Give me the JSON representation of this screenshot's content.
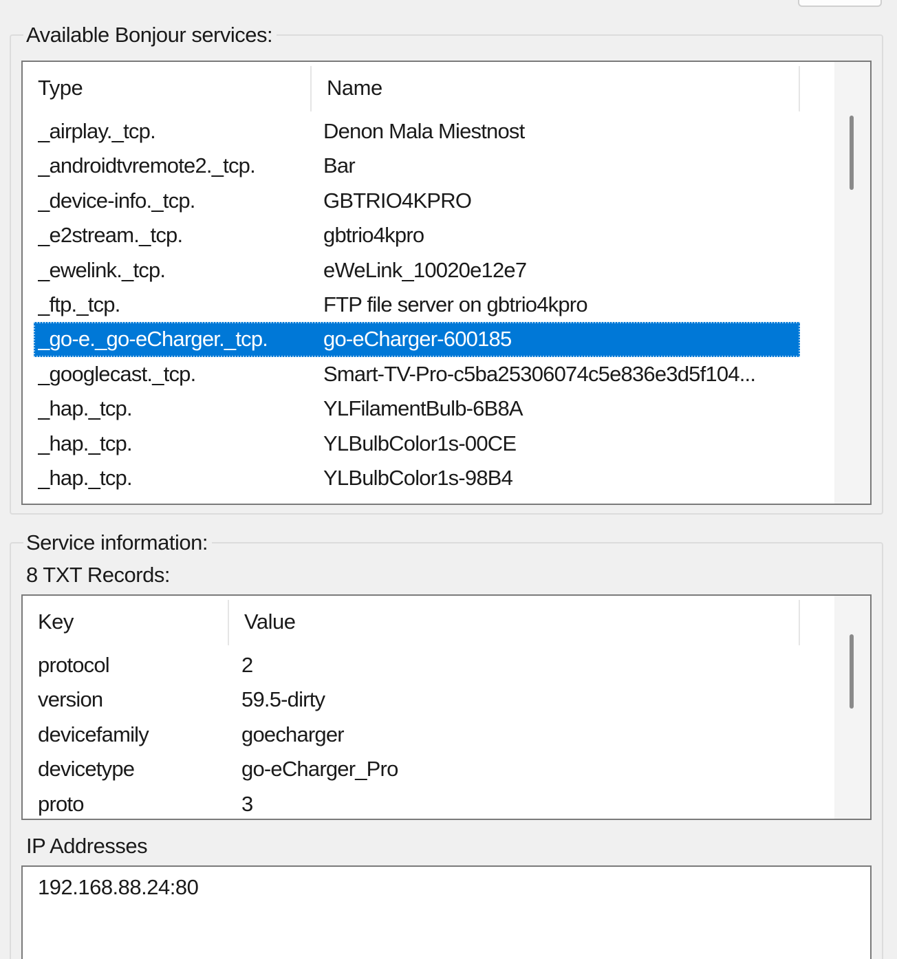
{
  "services_group": {
    "title": "Available Bonjour services:",
    "columns": {
      "type": "Type",
      "name": "Name"
    },
    "rows": [
      {
        "type": "_airplay._tcp.",
        "name": "Denon Mala Miestnost",
        "selected": false
      },
      {
        "type": "_androidtvremote2._tcp.",
        "name": "Bar",
        "selected": false
      },
      {
        "type": "_device-info._tcp.",
        "name": "GBTRIO4KPRO",
        "selected": false
      },
      {
        "type": "_e2stream._tcp.",
        "name": "gbtrio4kpro",
        "selected": false
      },
      {
        "type": "_ewelink._tcp.",
        "name": "eWeLink_10020e12e7",
        "selected": false
      },
      {
        "type": "_ftp._tcp.",
        "name": "FTP file server on gbtrio4kpro",
        "selected": false
      },
      {
        "type": "_go-e._go-eCharger._tcp.",
        "name": "go-eCharger-600185",
        "selected": true
      },
      {
        "type": "_googlecast._tcp.",
        "name": "Smart-TV-Pro-c5ba25306074c5e836e3d5f104...",
        "selected": false
      },
      {
        "type": "_hap._tcp.",
        "name": "YLFilamentBulb-6B8A",
        "selected": false
      },
      {
        "type": "_hap._tcp.",
        "name": "YLBulbColor1s-00CE",
        "selected": false
      },
      {
        "type": "_hap._tcp.",
        "name": "YLBulbColor1s-98B4",
        "selected": false
      }
    ]
  },
  "info_group": {
    "title": "Service information:",
    "txt_records_label": "8 TXT Records:",
    "columns": {
      "key": "Key",
      "value": "Value"
    },
    "records": [
      {
        "key": "protocol",
        "value": "2"
      },
      {
        "key": "version",
        "value": "59.5-dirty"
      },
      {
        "key": "devicefamily",
        "value": "goecharger"
      },
      {
        "key": "devicetype",
        "value": "go-eCharger_Pro"
      },
      {
        "key": "proto",
        "value": "3"
      }
    ],
    "ip_label": "IP Addresses",
    "ip_addresses": "192.168.88.24:80"
  },
  "colors": {
    "selection": "#0078d7",
    "background": "#f0f0f0",
    "list_background": "#ffffff"
  }
}
